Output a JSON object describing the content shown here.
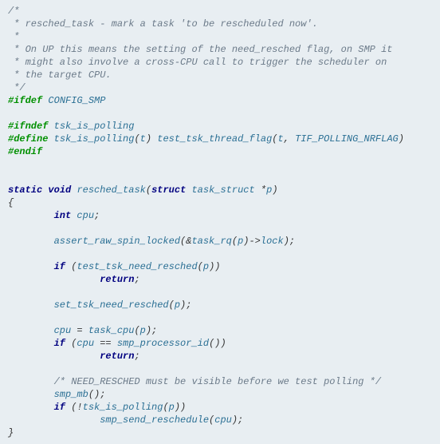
{
  "lines": [
    {
      "segs": [
        {
          "cls": "cmt",
          "t": "/*"
        }
      ]
    },
    {
      "segs": [
        {
          "cls": "cmt",
          "t": " * resched_task - mark a task 'to be rescheduled now'."
        }
      ]
    },
    {
      "segs": [
        {
          "cls": "cmt",
          "t": " *"
        }
      ]
    },
    {
      "segs": [
        {
          "cls": "cmt",
          "t": " * On UP this means the setting of the need_resched flag, on SMP it"
        }
      ]
    },
    {
      "segs": [
        {
          "cls": "cmt",
          "t": " * might also involve a cross-CPU call to trigger the scheduler on"
        }
      ]
    },
    {
      "segs": [
        {
          "cls": "cmt",
          "t": " * the target CPU."
        }
      ]
    },
    {
      "segs": [
        {
          "cls": "cmt",
          "t": " */"
        }
      ]
    },
    {
      "segs": [
        {
          "cls": "pp",
          "t": "#ifdef"
        },
        {
          "cls": "op",
          "t": " "
        },
        {
          "cls": "id",
          "t": "CONFIG_SMP"
        }
      ]
    },
    {
      "segs": [
        {
          "cls": "op",
          "t": ""
        }
      ]
    },
    {
      "segs": [
        {
          "cls": "pp",
          "t": "#ifndef"
        },
        {
          "cls": "op",
          "t": " "
        },
        {
          "cls": "id",
          "t": "tsk_is_polling"
        }
      ]
    },
    {
      "segs": [
        {
          "cls": "pp",
          "t": "#define"
        },
        {
          "cls": "op",
          "t": " "
        },
        {
          "cls": "id",
          "t": "tsk_is_polling"
        },
        {
          "cls": "op",
          "t": "("
        },
        {
          "cls": "id",
          "t": "t"
        },
        {
          "cls": "op",
          "t": ") "
        },
        {
          "cls": "id",
          "t": "test_tsk_thread_flag"
        },
        {
          "cls": "op",
          "t": "("
        },
        {
          "cls": "id",
          "t": "t"
        },
        {
          "cls": "op",
          "t": ", "
        },
        {
          "cls": "id",
          "t": "TIF_POLLING_NRFLAG"
        },
        {
          "cls": "op",
          "t": ")"
        }
      ]
    },
    {
      "segs": [
        {
          "cls": "pp",
          "t": "#endif"
        }
      ]
    },
    {
      "segs": [
        {
          "cls": "op",
          "t": ""
        }
      ]
    },
    {
      "segs": [
        {
          "cls": "op",
          "t": ""
        }
      ]
    },
    {
      "segs": [
        {
          "cls": "kw",
          "t": "static"
        },
        {
          "cls": "op",
          "t": " "
        },
        {
          "cls": "kw",
          "t": "void"
        },
        {
          "cls": "op",
          "t": " "
        },
        {
          "cls": "id",
          "t": "resched_task"
        },
        {
          "cls": "op",
          "t": "("
        },
        {
          "cls": "kw",
          "t": "struct"
        },
        {
          "cls": "op",
          "t": " "
        },
        {
          "cls": "id",
          "t": "task_struct"
        },
        {
          "cls": "op",
          "t": " *"
        },
        {
          "cls": "id",
          "t": "p"
        },
        {
          "cls": "op",
          "t": ")"
        }
      ]
    },
    {
      "segs": [
        {
          "cls": "op",
          "t": "{"
        }
      ]
    },
    {
      "segs": [
        {
          "cls": "op",
          "t": "        "
        },
        {
          "cls": "kw",
          "t": "int"
        },
        {
          "cls": "op",
          "t": " "
        },
        {
          "cls": "id",
          "t": "cpu"
        },
        {
          "cls": "op",
          "t": ";"
        }
      ]
    },
    {
      "segs": [
        {
          "cls": "op",
          "t": ""
        }
      ]
    },
    {
      "segs": [
        {
          "cls": "op",
          "t": "        "
        },
        {
          "cls": "id",
          "t": "assert_raw_spin_locked"
        },
        {
          "cls": "op",
          "t": "(&"
        },
        {
          "cls": "id",
          "t": "task_rq"
        },
        {
          "cls": "op",
          "t": "("
        },
        {
          "cls": "id",
          "t": "p"
        },
        {
          "cls": "op",
          "t": ")->"
        },
        {
          "cls": "id",
          "t": "lock"
        },
        {
          "cls": "op",
          "t": ");"
        }
      ]
    },
    {
      "segs": [
        {
          "cls": "op",
          "t": ""
        }
      ]
    },
    {
      "segs": [
        {
          "cls": "op",
          "t": "        "
        },
        {
          "cls": "kw",
          "t": "if"
        },
        {
          "cls": "op",
          "t": " ("
        },
        {
          "cls": "id",
          "t": "test_tsk_need_resched"
        },
        {
          "cls": "op",
          "t": "("
        },
        {
          "cls": "id",
          "t": "p"
        },
        {
          "cls": "op",
          "t": "))"
        }
      ]
    },
    {
      "segs": [
        {
          "cls": "op",
          "t": "                "
        },
        {
          "cls": "kw",
          "t": "return"
        },
        {
          "cls": "op",
          "t": ";"
        }
      ]
    },
    {
      "segs": [
        {
          "cls": "op",
          "t": ""
        }
      ]
    },
    {
      "segs": [
        {
          "cls": "op",
          "t": "        "
        },
        {
          "cls": "id",
          "t": "set_tsk_need_resched"
        },
        {
          "cls": "op",
          "t": "("
        },
        {
          "cls": "id",
          "t": "p"
        },
        {
          "cls": "op",
          "t": ");"
        }
      ]
    },
    {
      "segs": [
        {
          "cls": "op",
          "t": ""
        }
      ]
    },
    {
      "segs": [
        {
          "cls": "op",
          "t": "        "
        },
        {
          "cls": "id",
          "t": "cpu"
        },
        {
          "cls": "op",
          "t": " = "
        },
        {
          "cls": "id",
          "t": "task_cpu"
        },
        {
          "cls": "op",
          "t": "("
        },
        {
          "cls": "id",
          "t": "p"
        },
        {
          "cls": "op",
          "t": ");"
        }
      ]
    },
    {
      "segs": [
        {
          "cls": "op",
          "t": "        "
        },
        {
          "cls": "kw",
          "t": "if"
        },
        {
          "cls": "op",
          "t": " ("
        },
        {
          "cls": "id",
          "t": "cpu"
        },
        {
          "cls": "op",
          "t": " == "
        },
        {
          "cls": "id",
          "t": "smp_processor_id"
        },
        {
          "cls": "op",
          "t": "())"
        }
      ]
    },
    {
      "segs": [
        {
          "cls": "op",
          "t": "                "
        },
        {
          "cls": "kw",
          "t": "return"
        },
        {
          "cls": "op",
          "t": ";"
        }
      ]
    },
    {
      "segs": [
        {
          "cls": "op",
          "t": ""
        }
      ]
    },
    {
      "segs": [
        {
          "cls": "op",
          "t": "        "
        },
        {
          "cls": "cmt",
          "t": "/* NEED_RESCHED must be visible before we test polling */"
        }
      ]
    },
    {
      "segs": [
        {
          "cls": "op",
          "t": "        "
        },
        {
          "cls": "id",
          "t": "smp_mb"
        },
        {
          "cls": "op",
          "t": "();"
        }
      ]
    },
    {
      "segs": [
        {
          "cls": "op",
          "t": "        "
        },
        {
          "cls": "kw",
          "t": "if"
        },
        {
          "cls": "op",
          "t": " (!"
        },
        {
          "cls": "id",
          "t": "tsk_is_polling"
        },
        {
          "cls": "op",
          "t": "("
        },
        {
          "cls": "id",
          "t": "p"
        },
        {
          "cls": "op",
          "t": "))"
        }
      ]
    },
    {
      "segs": [
        {
          "cls": "op",
          "t": "                "
        },
        {
          "cls": "id",
          "t": "smp_send_reschedule"
        },
        {
          "cls": "op",
          "t": "("
        },
        {
          "cls": "id",
          "t": "cpu"
        },
        {
          "cls": "op",
          "t": ");"
        }
      ]
    },
    {
      "segs": [
        {
          "cls": "op",
          "t": "}"
        }
      ]
    }
  ]
}
